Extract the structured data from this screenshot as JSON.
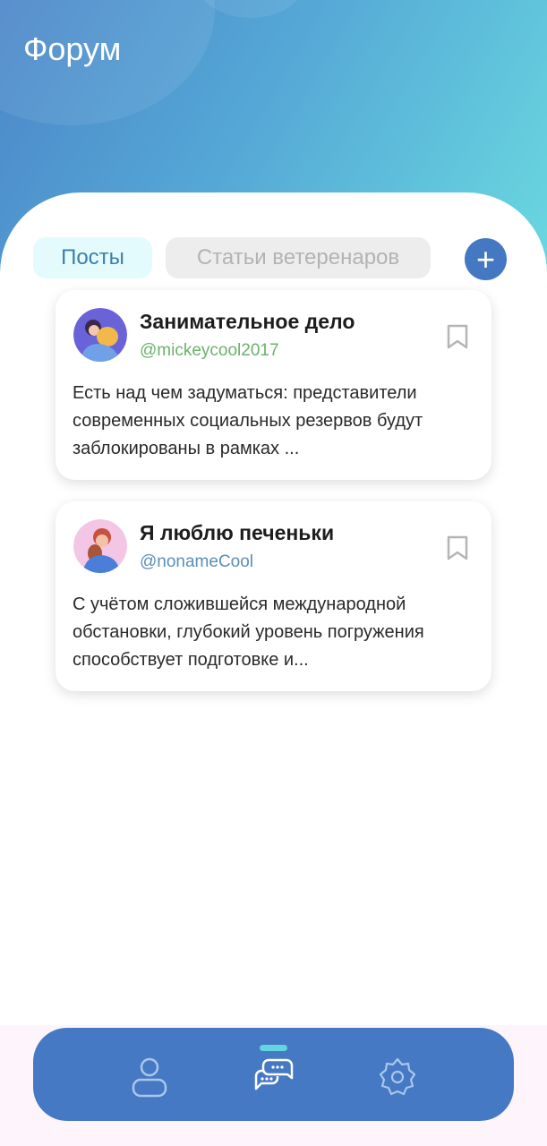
{
  "header": {
    "title": "Форум"
  },
  "tabs": [
    {
      "label": "Посты",
      "active": true
    },
    {
      "label": "Статьи ветеренаров",
      "active": false
    }
  ],
  "add_button": {
    "label": "+"
  },
  "posts": [
    {
      "title": "Занимательное дело",
      "handle": "@mickeycool2017",
      "handle_color": "#6ab26a",
      "text": "Есть над чем задуматься: представители современных социальных резервов будут заблокированы в рамках ..."
    },
    {
      "title": "Я люблю печеньки",
      "handle": "@nonameCool",
      "handle_color": "#5a8fb8",
      "text": "С учётом сложившейся международной обстановки, глубокий уровень погружения способствует подготовке и..."
    }
  ],
  "nav": {
    "items": [
      {
        "icon": "user-icon"
      },
      {
        "icon": "chat-icon",
        "active": true
      },
      {
        "icon": "gear-icon"
      }
    ],
    "accent": "#4579c3"
  }
}
